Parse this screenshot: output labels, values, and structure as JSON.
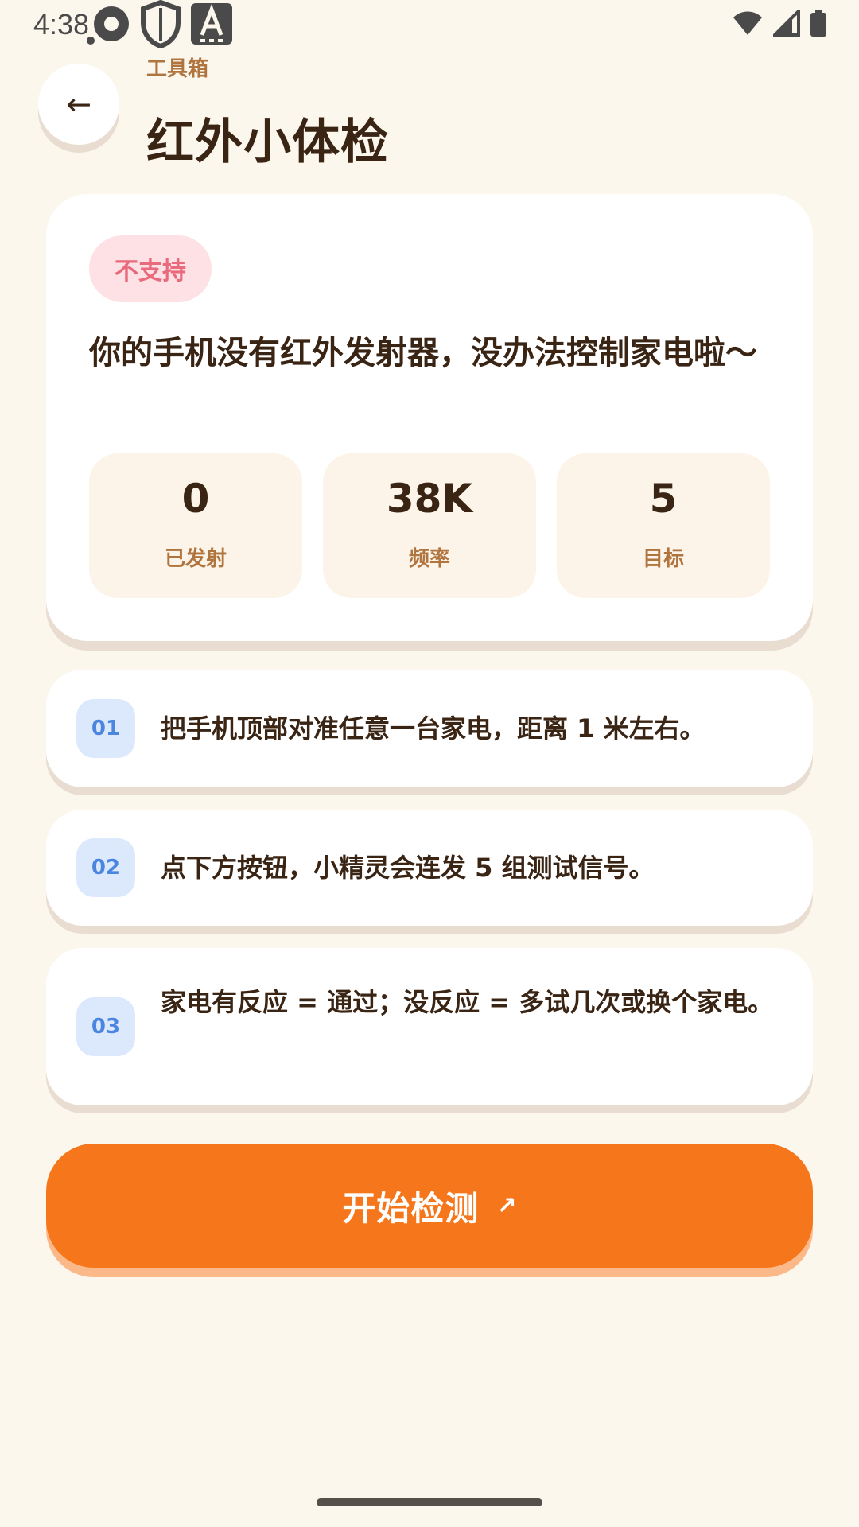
{
  "status_bar": {
    "time": "4:38"
  },
  "header": {
    "back_label": "←",
    "eyebrow": "工具箱",
    "title": "红外小体检"
  },
  "status_card": {
    "badge": "不支持",
    "message": "你的手机没有红外发射器，没办法控制家电啦～",
    "stats": [
      {
        "value": "0",
        "label": "已发射"
      },
      {
        "value": "38K",
        "label": "频率"
      },
      {
        "value": "5",
        "label": "目标"
      }
    ]
  },
  "steps": [
    {
      "num": "01",
      "text": "把手机顶部对准任意一台家电，距离 1 米左右。"
    },
    {
      "num": "02",
      "text": "点下方按钮，小精灵会连发 5 组测试信号。"
    },
    {
      "num": "03",
      "text": "家电有反应 = 通过；没反应 = 多试几次或换个家电。"
    }
  ],
  "start_button": {
    "label": "开始检测",
    "arrow": "↗"
  },
  "colors": {
    "background": "#FCF7ED",
    "accent": "#F5761B",
    "badge_text": "#E96A7D",
    "badge_bg": "#FDE1E4",
    "step_number": "#4A86E0",
    "muted_brown": "#B0743F"
  }
}
